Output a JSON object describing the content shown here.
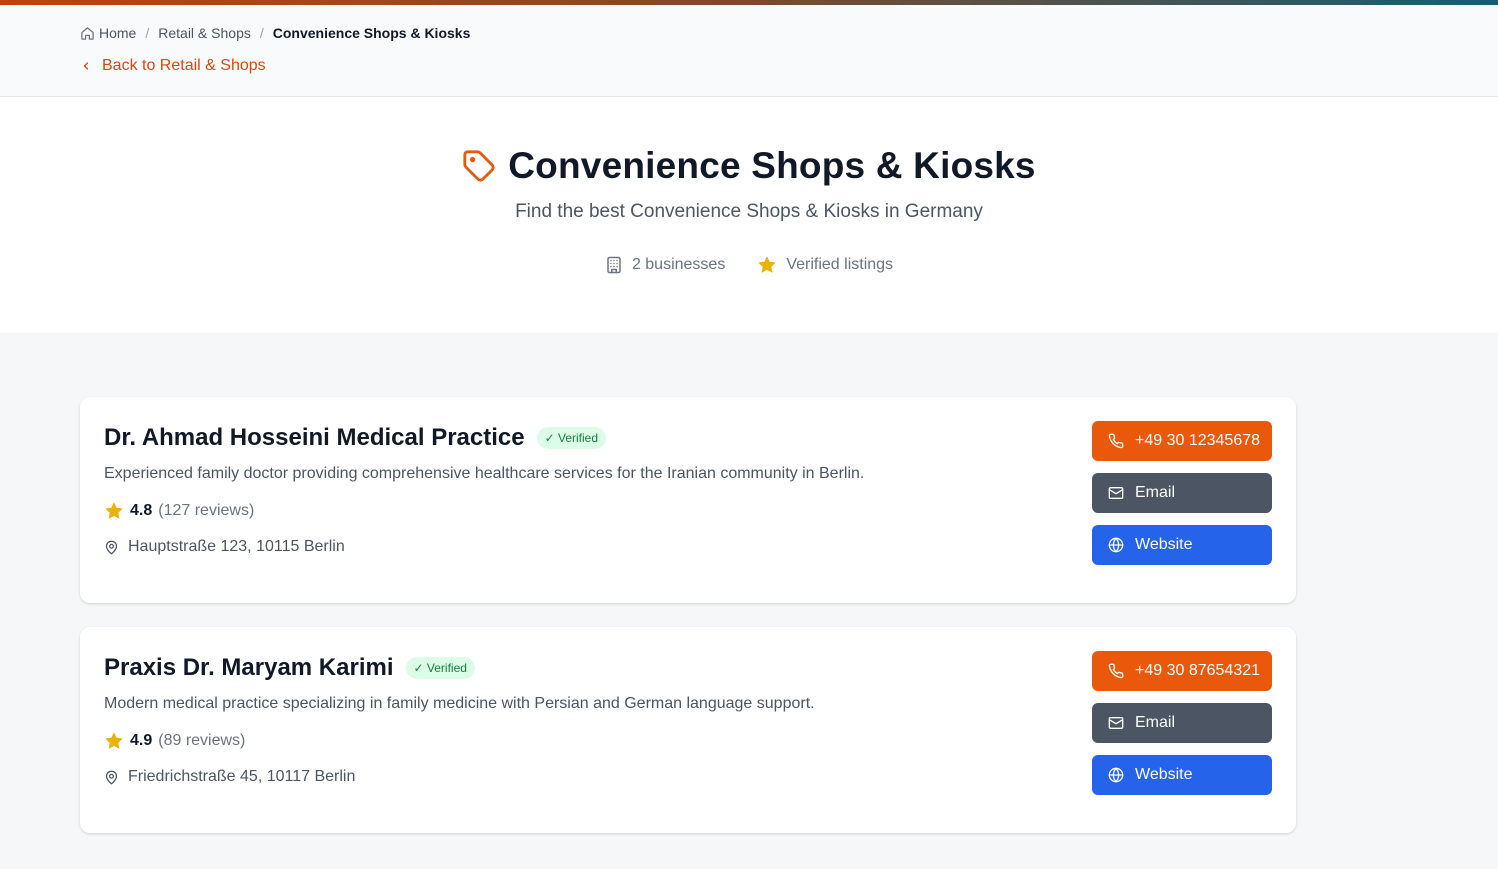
{
  "breadcrumb": {
    "home": "Home",
    "parent": "Retail & Shops",
    "current": "Convenience Shops & Kiosks",
    "separator": "/"
  },
  "back_link": "Back to Retail & Shops",
  "hero": {
    "title": "Convenience Shops & Kiosks",
    "subtitle": "Find the best Convenience Shops & Kiosks in Germany",
    "stats": {
      "businesses": "2 businesses",
      "verified": "Verified listings"
    }
  },
  "colors": {
    "accent": "#ea580c",
    "email_button": "#4b5563",
    "website_button": "#2563eb",
    "star": "#eab308",
    "verified_bg": "#dcfce7",
    "verified_text": "#15803d"
  },
  "listings": [
    {
      "name": "Dr. Ahmad Hosseini Medical Practice",
      "badge": "✓ Verified",
      "description": "Experienced family doctor providing comprehensive healthcare services for the Iranian community in Berlin.",
      "rating": "4.8",
      "reviews": "(127 reviews)",
      "address": "Hauptstraße 123, 10115 Berlin",
      "phone": "+49 30 12345678",
      "email_label": "Email",
      "website_label": "Website"
    },
    {
      "name": "Praxis Dr. Maryam Karimi",
      "badge": "✓ Verified",
      "description": "Modern medical practice specializing in family medicine with Persian and German language support.",
      "rating": "4.9",
      "reviews": "(89 reviews)",
      "address": "Friedrichstraße 45, 10117 Berlin",
      "phone": "+49 30 87654321",
      "email_label": "Email",
      "website_label": "Website"
    }
  ]
}
